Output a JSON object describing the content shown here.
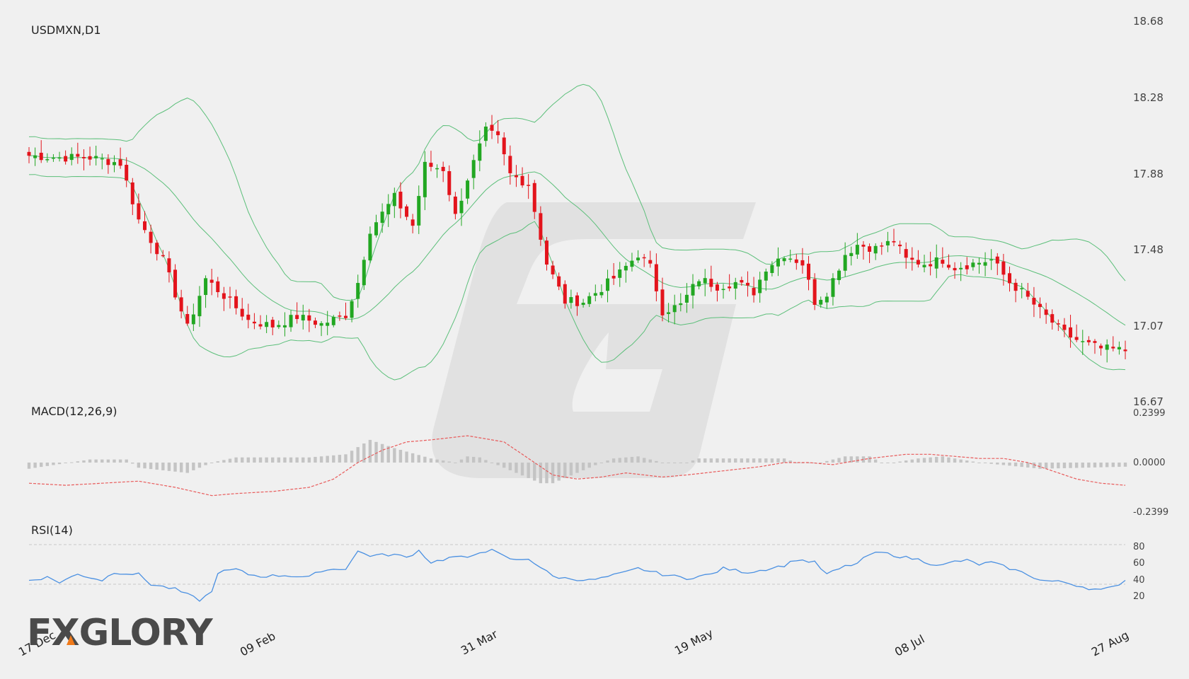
{
  "colors": {
    "up": "#22a722",
    "down": "#e3141c",
    "bollinger": "#5cbf7a",
    "macd_hist": "#c4c4c4",
    "macd_signal": "#e85a5a",
    "rsi": "#4a90e2",
    "rsi_levels": "#c8c8c8",
    "watermark": "#dcdcdc",
    "logo": "#4a4a4a",
    "logo_accent": "#f07a1a"
  },
  "chart_data": [
    {
      "type": "candlestick",
      "title": "USDMXN,D1",
      "ylim": [
        16.67,
        18.68
      ],
      "y_ticks": [
        "18.68",
        "18.28",
        "17.88",
        "17.48",
        "17.07",
        "16.67"
      ],
      "x_ticks": [
        "17 Dec",
        "09 Feb",
        "31 Mar",
        "19 May",
        "08 Jul",
        "27 Aug"
      ],
      "anchors": [
        [
          0,
          17.97
        ],
        [
          5,
          17.96
        ],
        [
          10,
          17.96
        ],
        [
          15,
          17.93
        ],
        [
          18,
          17.63
        ],
        [
          22,
          17.42
        ],
        [
          26,
          17.06
        ],
        [
          29,
          17.32
        ],
        [
          33,
          17.2
        ],
        [
          36,
          17.1
        ],
        [
          40,
          17.07
        ],
        [
          44,
          17.12
        ],
        [
          48,
          17.08
        ],
        [
          52,
          17.13
        ],
        [
          54,
          17.3
        ],
        [
          56,
          17.58
        ],
        [
          60,
          17.75
        ],
        [
          63,
          17.6
        ],
        [
          65,
          17.92
        ],
        [
          68,
          17.9
        ],
        [
          70,
          17.65
        ],
        [
          72,
          17.85
        ],
        [
          75,
          18.1
        ],
        [
          77,
          18.06
        ],
        [
          79,
          17.87
        ],
        [
          82,
          17.82
        ],
        [
          85,
          17.4
        ],
        [
          88,
          17.2
        ],
        [
          91,
          17.2
        ],
        [
          94,
          17.27
        ],
        [
          97,
          17.35
        ],
        [
          100,
          17.45
        ],
        [
          102,
          17.38
        ],
        [
          104,
          17.15
        ],
        [
          107,
          17.18
        ],
        [
          110,
          17.32
        ],
        [
          113,
          17.28
        ],
        [
          116,
          17.3
        ],
        [
          119,
          17.25
        ],
        [
          121,
          17.38
        ],
        [
          124,
          17.45
        ],
        [
          127,
          17.4
        ],
        [
          129,
          17.2
        ],
        [
          131,
          17.25
        ],
        [
          134,
          17.45
        ],
        [
          136,
          17.5
        ],
        [
          139,
          17.48
        ],
        [
          142,
          17.52
        ],
        [
          144,
          17.42
        ],
        [
          147,
          17.4
        ],
        [
          150,
          17.42
        ],
        [
          152,
          17.38
        ],
        [
          155,
          17.4
        ],
        [
          158,
          17.42
        ],
        [
          161,
          17.3
        ],
        [
          163,
          17.25
        ],
        [
          166,
          17.15
        ],
        [
          170,
          17.03
        ],
        [
          173,
          16.98
        ],
        [
          176,
          16.95
        ],
        [
          180,
          16.94
        ]
      ]
    },
    {
      "type": "histogram+line",
      "title": "MACD(12,26,9)",
      "ylim": [
        -0.2399,
        0.2399
      ],
      "y_ticks": [
        "0.2399",
        "0.0000",
        "-0.2399"
      ],
      "hist_anchors": [
        [
          0,
          -0.03
        ],
        [
          10,
          0.015
        ],
        [
          16,
          0.015
        ],
        [
          18,
          -0.025
        ],
        [
          26,
          -0.05
        ],
        [
          30,
          0.0
        ],
        [
          34,
          0.025
        ],
        [
          46,
          0.025
        ],
        [
          52,
          0.04
        ],
        [
          56,
          0.11
        ],
        [
          60,
          0.07
        ],
        [
          66,
          0.02
        ],
        [
          70,
          0.0
        ],
        [
          72,
          0.03
        ],
        [
          74,
          0.025
        ],
        [
          76,
          0.0
        ],
        [
          80,
          -0.05
        ],
        [
          84,
          -0.1
        ],
        [
          86,
          -0.1
        ],
        [
          90,
          -0.05
        ],
        [
          94,
          0.0
        ],
        [
          96,
          0.02
        ],
        [
          100,
          0.03
        ],
        [
          104,
          0.0
        ],
        [
          108,
          0.0
        ],
        [
          110,
          0.02
        ],
        [
          124,
          0.02
        ],
        [
          126,
          0.0
        ],
        [
          130,
          0.0
        ],
        [
          134,
          0.03
        ],
        [
          138,
          0.03
        ],
        [
          140,
          0.0
        ],
        [
          142,
          0.0
        ],
        [
          146,
          0.02
        ],
        [
          150,
          0.03
        ],
        [
          156,
          0.0
        ],
        [
          166,
          -0.03
        ],
        [
          180,
          -0.02
        ]
      ],
      "signal_anchors": [
        [
          0,
          -0.1
        ],
        [
          6,
          -0.11
        ],
        [
          12,
          -0.1
        ],
        [
          18,
          -0.09
        ],
        [
          24,
          -0.12
        ],
        [
          30,
          -0.16
        ],
        [
          34,
          -0.15
        ],
        [
          40,
          -0.14
        ],
        [
          46,
          -0.12
        ],
        [
          50,
          -0.08
        ],
        [
          54,
          0.0
        ],
        [
          58,
          0.06
        ],
        [
          62,
          0.1
        ],
        [
          66,
          0.11
        ],
        [
          72,
          0.13
        ],
        [
          78,
          0.1
        ],
        [
          82,
          0.02
        ],
        [
          86,
          -0.06
        ],
        [
          90,
          -0.08
        ],
        [
          94,
          -0.07
        ],
        [
          98,
          -0.05
        ],
        [
          104,
          -0.07
        ],
        [
          108,
          -0.06
        ],
        [
          114,
          -0.04
        ],
        [
          120,
          -0.02
        ],
        [
          124,
          0.0
        ],
        [
          128,
          0.0
        ],
        [
          132,
          -0.01
        ],
        [
          138,
          0.02
        ],
        [
          144,
          0.04
        ],
        [
          148,
          0.04
        ],
        [
          152,
          0.03
        ],
        [
          156,
          0.02
        ],
        [
          160,
          0.02
        ],
        [
          164,
          0.0
        ],
        [
          168,
          -0.04
        ],
        [
          172,
          -0.08
        ],
        [
          176,
          -0.1
        ],
        [
          180,
          -0.11
        ]
      ]
    },
    {
      "type": "line",
      "title": "RSI(14)",
      "ylim": [
        0,
        100
      ],
      "y_ticks": [
        "80",
        "60",
        "40",
        "20"
      ],
      "levels": [
        70,
        30
      ],
      "anchors": [
        [
          0,
          34
        ],
        [
          3,
          37
        ],
        [
          5,
          32
        ],
        [
          8,
          40
        ],
        [
          12,
          34
        ],
        [
          14,
          42
        ],
        [
          18,
          40
        ],
        [
          20,
          30
        ],
        [
          24,
          25
        ],
        [
          28,
          14
        ],
        [
          30,
          22
        ],
        [
          31,
          42
        ],
        [
          34,
          45
        ],
        [
          36,
          40
        ],
        [
          38,
          38
        ],
        [
          42,
          39
        ],
        [
          46,
          37
        ],
        [
          48,
          44
        ],
        [
          50,
          45
        ],
        [
          52,
          46
        ],
        [
          54,
          63
        ],
        [
          56,
          59
        ],
        [
          60,
          60
        ],
        [
          62,
          57
        ],
        [
          64,
          64
        ],
        [
          66,
          52
        ],
        [
          70,
          58
        ],
        [
          72,
          56
        ],
        [
          74,
          63
        ],
        [
          76,
          64
        ],
        [
          78,
          58
        ],
        [
          80,
          54
        ],
        [
          82,
          56
        ],
        [
          84,
          47
        ],
        [
          86,
          38
        ],
        [
          88,
          36
        ],
        [
          92,
          34
        ],
        [
          94,
          36
        ],
        [
          98,
          42
        ],
        [
          100,
          46
        ],
        [
          104,
          40
        ],
        [
          108,
          36
        ],
        [
          112,
          40
        ],
        [
          114,
          46
        ],
        [
          116,
          44
        ],
        [
          118,
          42
        ],
        [
          120,
          44
        ],
        [
          124,
          49
        ],
        [
          126,
          55
        ],
        [
          129,
          52
        ],
        [
          131,
          40
        ],
        [
          134,
          48
        ],
        [
          136,
          51
        ],
        [
          138,
          60
        ],
        [
          140,
          62
        ],
        [
          143,
          58
        ],
        [
          146,
          55
        ],
        [
          148,
          51
        ],
        [
          150,
          49
        ],
        [
          152,
          53
        ],
        [
          154,
          54
        ],
        [
          156,
          50
        ],
        [
          158,
          52
        ],
        [
          160,
          48
        ],
        [
          162,
          44
        ],
        [
          164,
          40
        ],
        [
          166,
          34
        ],
        [
          170,
          32
        ],
        [
          174,
          26
        ],
        [
          176,
          24
        ],
        [
          178,
          27
        ],
        [
          180,
          34
        ]
      ]
    }
  ],
  "brand": {
    "logo_text": "FXGLORY"
  }
}
